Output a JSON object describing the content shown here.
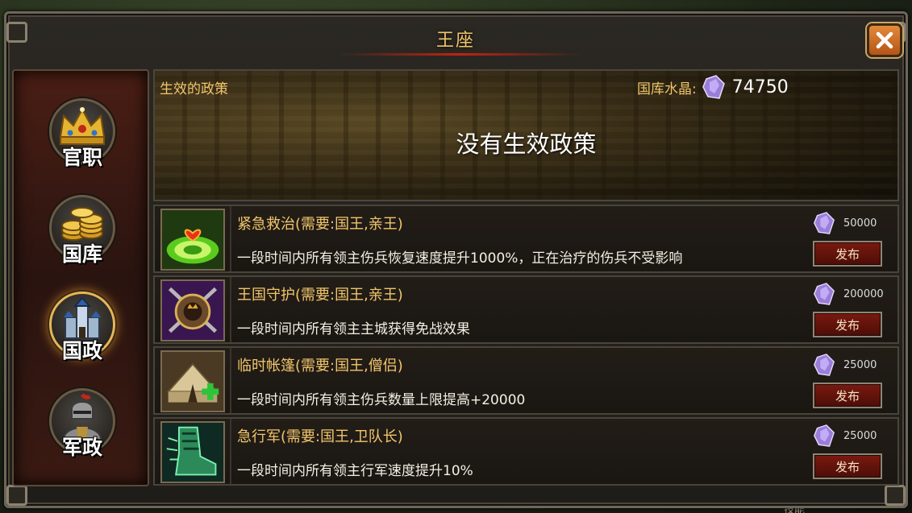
{
  "window": {
    "title": "王座"
  },
  "sidebar": {
    "items": [
      {
        "label": "官职",
        "icon": "crown-icon",
        "active": false
      },
      {
        "label": "国库",
        "icon": "gold-coins-icon",
        "active": false
      },
      {
        "label": "国政",
        "icon": "castle-icon",
        "active": true
      },
      {
        "label": "军政",
        "icon": "knight-icon",
        "active": false
      }
    ]
  },
  "banner": {
    "label": "生效的政策",
    "treasury_label": "国库水晶:",
    "treasury_value": "74750",
    "empty_text": "没有生效政策"
  },
  "policies": [
    {
      "name": "紧急救治(需要:国王,亲王)",
      "desc": "一段时间内所有领主伤兵恢复速度提升1000%，正在治疗的伤兵不受影响",
      "cost": "50000",
      "button": "发布",
      "icon": "heal-icon"
    },
    {
      "name": "王国守护(需要:国王,亲王)",
      "desc": "一段时间内所有领主主城获得免战效果",
      "cost": "200000",
      "button": "发布",
      "icon": "shield-icon"
    },
    {
      "name": "临时帐篷(需要:国王,僧侣)",
      "desc": "一段时间内所有领主伤兵数量上限提高+20000",
      "cost": "25000",
      "button": "发布",
      "icon": "tent-icon"
    },
    {
      "name": "急行军(需要:国王,卫队长)",
      "desc": "一段时间内所有领主行军速度提升10%",
      "cost": "25000",
      "button": "发布",
      "icon": "boot-icon"
    }
  ],
  "background": {
    "peek_text": "技能"
  },
  "colors": {
    "gold_text": "#f2c56b",
    "button_red": "#7a1a10",
    "active_glow": "#e7b65a"
  }
}
